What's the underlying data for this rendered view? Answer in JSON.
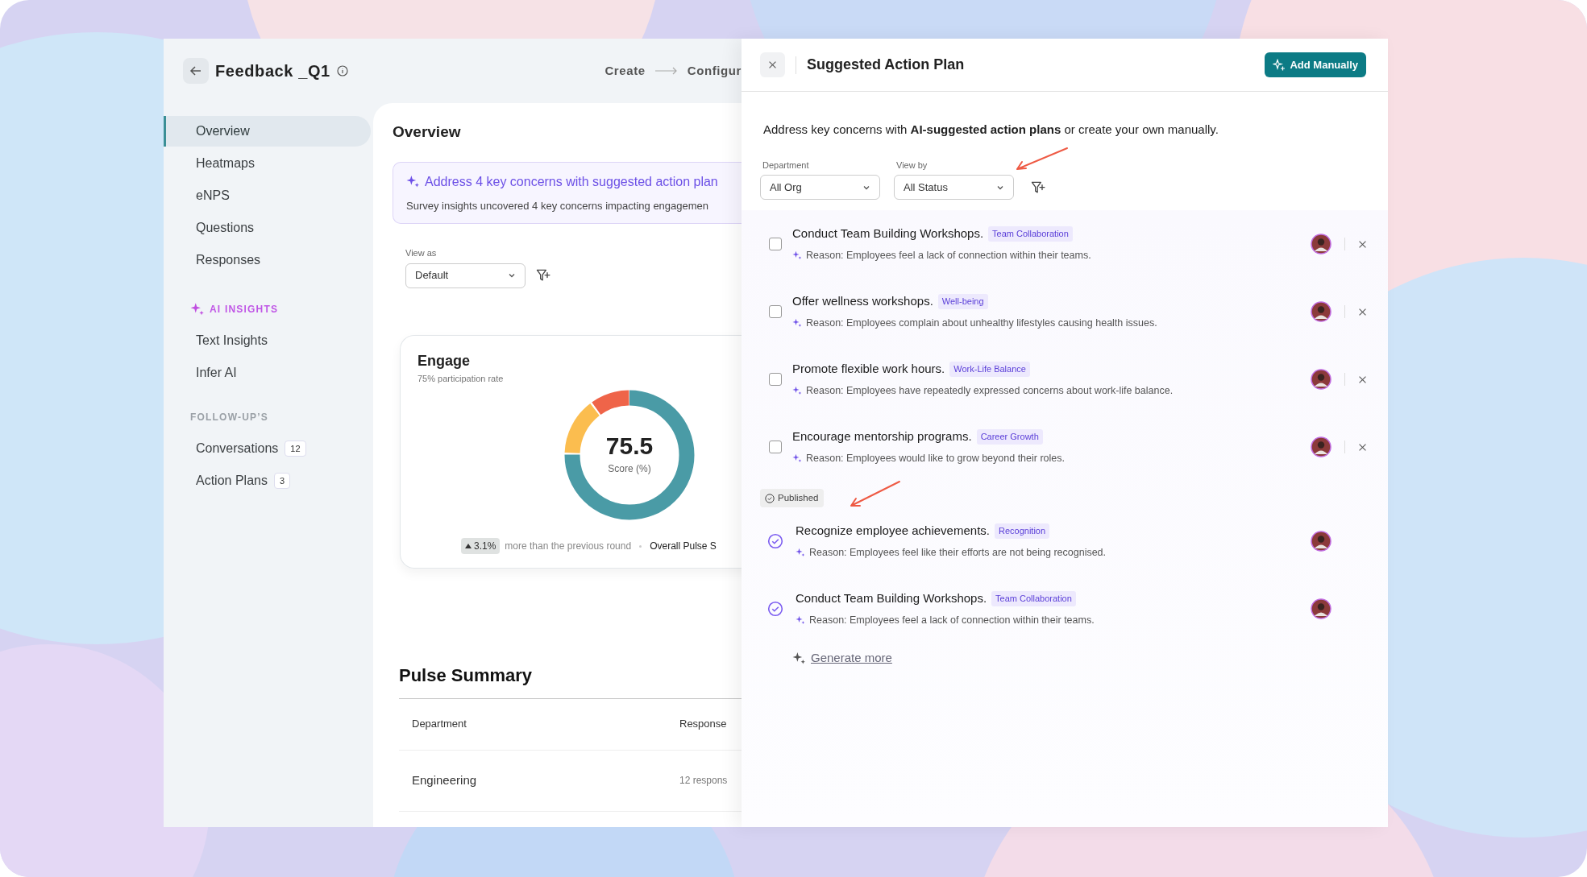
{
  "header": {
    "title": "Feedback _Q1",
    "steps": [
      "Create",
      "Configur"
    ]
  },
  "sidebar": {
    "groups": [
      {
        "items": [
          {
            "label": "Overview",
            "selected": true
          },
          {
            "label": "Heatmaps",
            "selected": false
          },
          {
            "label": "eNPS",
            "selected": false
          },
          {
            "label": "Questions",
            "selected": false
          },
          {
            "label": "Responses",
            "selected": false
          }
        ]
      },
      {
        "kind": "ai",
        "heading": "AI INSIGHTS",
        "items": [
          {
            "label": "Text Insights",
            "selected": false
          },
          {
            "label": "Infer AI",
            "selected": false
          }
        ]
      },
      {
        "kind": "plain",
        "heading": "FOLLOW-UP’S",
        "items": [
          {
            "label": "Conversations",
            "count": "12",
            "selected": false
          },
          {
            "label": "Action Plans",
            "count": "3",
            "selected": false
          }
        ]
      }
    ]
  },
  "overview": {
    "title": "Overview",
    "banner": {
      "title": "Address 4 key concerns with suggested action plan",
      "text": "Survey insights uncovered 4 key concerns impacting engagemen"
    },
    "view_as": {
      "label": "View as",
      "value": "Default"
    },
    "engage": {
      "title": "Engage",
      "subtitle": "75% participation rate",
      "score": "75.5",
      "score_label": "Score (%)",
      "change": "3.1%",
      "change_text": "more than the previous round",
      "overall": "Overall Pulse S"
    }
  },
  "pulse_summary": {
    "title": "Pulse Summary",
    "columns": [
      "Department",
      "Response"
    ],
    "rows": [
      [
        "Engineering",
        "12 respons"
      ]
    ]
  },
  "panel": {
    "title": "Suggested Action Plan",
    "add_button": "Add Manually",
    "description": "Address key concerns with **AI-suggested action plans** or create your own manually.",
    "filters": [
      {
        "label": "Department",
        "value": "All Org"
      },
      {
        "label": "View by",
        "value": "All Status"
      }
    ],
    "suggested": [
      {
        "title": "Conduct Team Building Workshops.",
        "tag": "Team Collaboration",
        "reason": "Reason: Employees feel a lack of connection within their teams.",
        "checked": false
      },
      {
        "title": "Offer wellness workshops.",
        "tag": "Well-being",
        "reason": "Reason: Employees complain about unhealthy lifestyles causing health issues.",
        "checked": false
      },
      {
        "title": "Promote flexible work hours.",
        "tag": "Work-Life Balance",
        "reason": "Reason: Employees have repeatedly expressed concerns about work-life balance.",
        "checked": false
      },
      {
        "title": "Encourage mentorship programs.",
        "tag": "Career Growth",
        "reason": "Reason: Employees would like to grow beyond their roles.",
        "checked": false
      }
    ],
    "published_label": "Published",
    "published": [
      {
        "title": "Recognize employee achievements.",
        "tag": "Recognition",
        "reason": "Reason: Employees feel like their efforts are not being recognised."
      },
      {
        "title": "Conduct Team Building Workshops.",
        "tag": "Team Collaboration",
        "reason": "Reason: Employees feel a lack of connection within their teams."
      }
    ],
    "generate": "Generate more"
  }
}
